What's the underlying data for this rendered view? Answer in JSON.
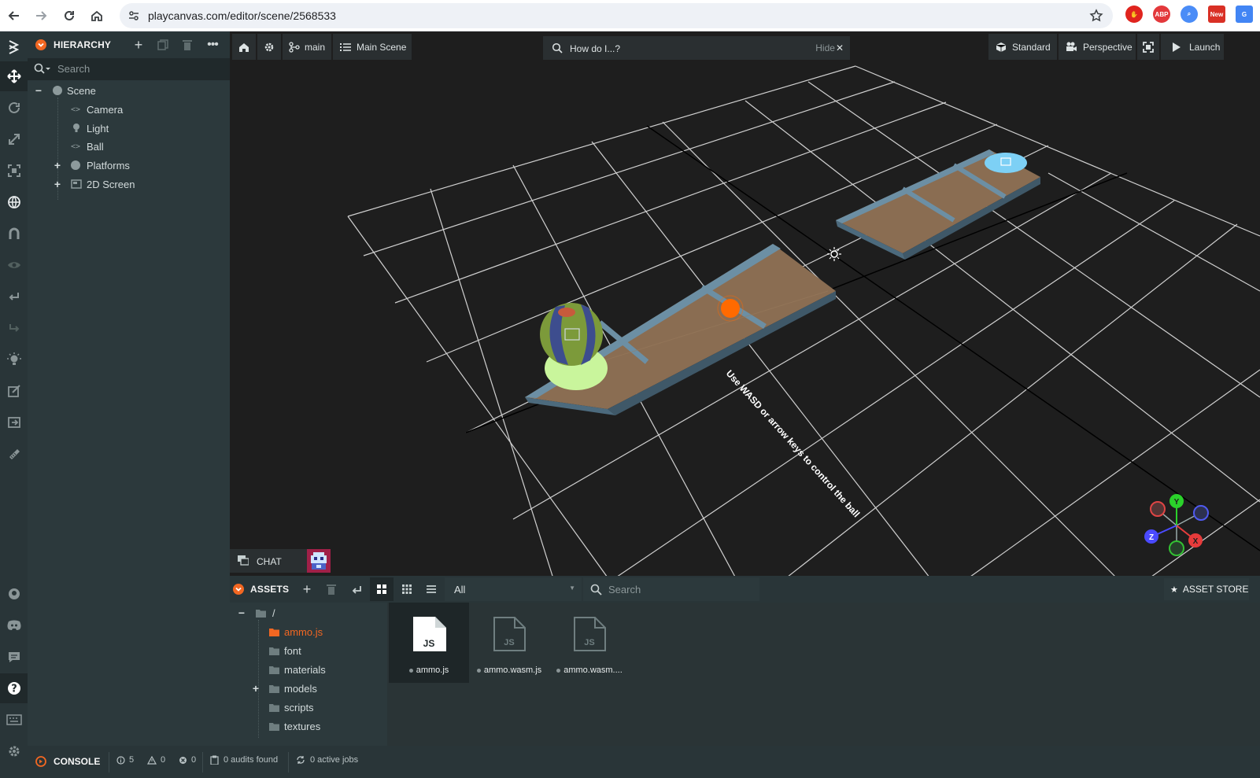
{
  "browser": {
    "url": "playcanvas.com/editor/scene/2568533",
    "extensions": [
      {
        "icon": "shield-stop-icon",
        "label": "",
        "color": "#e0241e"
      },
      {
        "icon": "adblock-plus-icon",
        "label": "ABP",
        "color": "#e3383b"
      },
      {
        "icon": "search-ext-icon",
        "label": "",
        "color": "#4a8cf7"
      },
      {
        "icon": "new-ext-icon",
        "label": "New",
        "color": "#d93025"
      },
      {
        "icon": "translate-icon",
        "label": "",
        "color": "#4285f4"
      }
    ]
  },
  "hierarchy": {
    "title": "HIERARCHY",
    "search_placeholder": "Search",
    "tree": [
      {
        "label": "Scene",
        "icon": "entity-dot-icon",
        "expand": "−"
      },
      {
        "label": "Camera",
        "icon": "code-icon"
      },
      {
        "label": "Light",
        "icon": "bulb-icon"
      },
      {
        "label": "Ball",
        "icon": "code-icon"
      },
      {
        "label": "Platforms",
        "icon": "entity-dot-icon",
        "expand": "+"
      },
      {
        "label": "2D Screen",
        "icon": "screen-icon",
        "expand": "+"
      }
    ]
  },
  "viewport": {
    "branch": "main",
    "scene": "Main Scene",
    "help_placeholder": "How do I...?",
    "help_hide": "Hide",
    "render_mode": "Standard",
    "camera": "Perspective",
    "launch": "Launch",
    "scene_text": "Use WASD or arrow keys to control the ball",
    "gizmo_labels": {
      "y": "Y",
      "x": "X",
      "z": "Z"
    }
  },
  "chat": {
    "label": "CHAT"
  },
  "assets": {
    "title": "ASSETS",
    "filter": "All",
    "search_placeholder": "Search",
    "store": "ASSET STORE",
    "root": "/",
    "folders": [
      "ammo.js",
      "font",
      "materials",
      "models",
      "scripts",
      "textures"
    ],
    "files": [
      {
        "name": "ammo.js",
        "type": "JS",
        "selected": true
      },
      {
        "name": "ammo.wasm.js",
        "type": "JS",
        "selected": false
      },
      {
        "name": "ammo.wasm....",
        "type": "JS",
        "selected": false
      }
    ]
  },
  "console": {
    "title": "CONSOLE",
    "info_count": "5",
    "warn_count": "0",
    "error_count": "0",
    "audits": "0 audits found",
    "jobs": "0 active jobs"
  },
  "colors": {
    "accent": "#f26722",
    "panel": "#2c393c",
    "header": "#293538",
    "viewport": "#1e1e1e"
  }
}
